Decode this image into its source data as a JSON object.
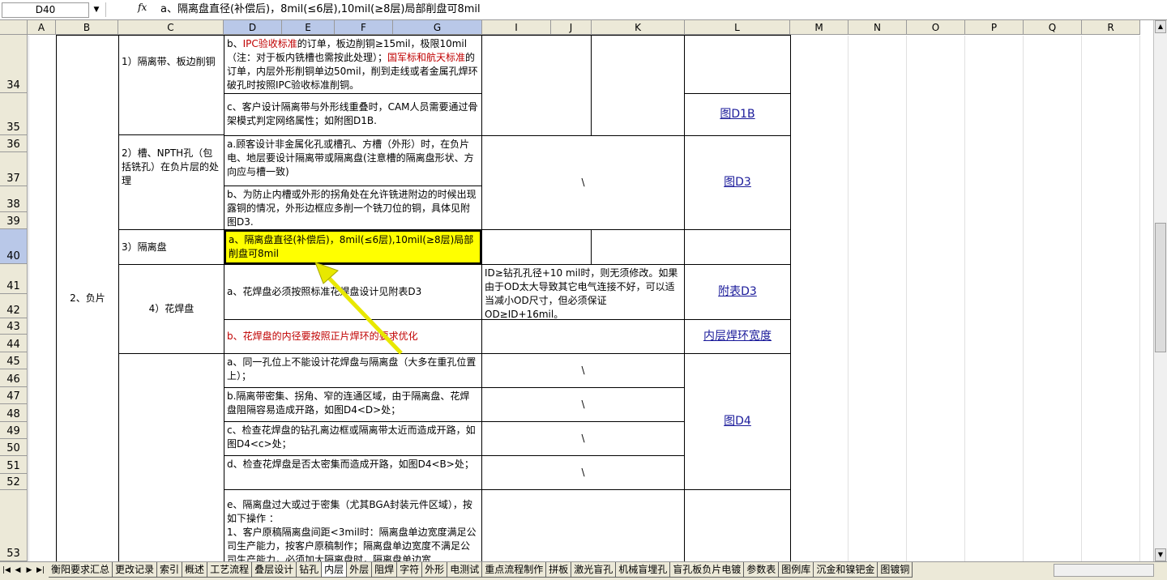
{
  "formula_bar": {
    "name_box": "D40",
    "fx_label": "fx",
    "formula": "a、隔离盘直径(补偿后)，8mil(≤6层),10mil(≥8层)局部削盘可8mil"
  },
  "column_headers": [
    "A",
    "B",
    "C",
    "D",
    "E",
    "F",
    "G",
    "I",
    "J",
    "K",
    "L",
    "M",
    "N",
    "O",
    "P",
    "Q",
    "R"
  ],
  "row_headers": [
    "34",
    "35",
    "36",
    "37",
    "38",
    "39",
    "40",
    "41",
    "42",
    "43",
    "44",
    "45",
    "46",
    "47",
    "48",
    "49",
    "50",
    "51",
    "52",
    "53"
  ],
  "cells": {
    "b_label": "2、负片",
    "c_section1": "1）隔离带、板边削铜",
    "c_section2": "2）槽、NPTH孔（包括铣孔）在负片层的处理",
    "c_section3": "3）隔离盘",
    "c_section4": "4）花焊盘",
    "r34_a": "b、",
    "r34_b": "IPC验收标准",
    "r34_c": "的订单，板边削铜≥15mil，极限10mil（注：对于板内铣槽也需按此处理）；",
    "r34_d": "国军标和航天标准",
    "r34_e": "的订单，内层外形削铜单边50mil，削到走线或者金属孔焊环破孔时按照IPC验收标准削铜。",
    "r35": "c、客户设计隔离带与外形线重叠时，CAM人员需要通过骨架模式判定网络属性；如附图D1B.",
    "r37": "a.顾客设计非金属化孔或槽孔、方槽（外形）时，在负片电、地层要设计隔离带或隔离盘(注意槽的隔离盘形状、方向应与槽一致)",
    "r38": "b、为防止内槽或外形的拐角处在允许铣进附边的时候出现露铜的情况，外形边框应多削一个铣刀位的铜，具体见附图D3.",
    "r40": "a、隔离盘直径(补偿后)，8mil(≤6层),10mil(≥8层)局部削盘可8mil",
    "r41": "a、花焊盘必须按照标准花焊盘设计见附表D3",
    "r41_note": "ID≥钻孔孔径+10 mil时，则无须修改。如果由于OD太大导致其它电气连接不好，可以适当减小OD尺寸，但必须保证OD≥ID+16mil。",
    "r43": "b、花焊盘的内径要按照正片焊环的要求优化",
    "r45": "a、同一孔位上不能设计花焊盘与隔离盘（大多在重孔位置上）；",
    "r47": "b.隔离带密集、拐角、窄的连通区域，由于隔离盘、花焊盘阻隔容易造成开路，如图D4<D>处；",
    "r49": "c、检查花焊盘的钻孔离边框或隔离带太近而造成开路，如图D4<c>处；",
    "r51": "d、检查花焊盘是否太密集而造成开路，如图D4<B>处；",
    "r53": "e、隔离盘过大或过于密集（尤其BGA封装元件区域），按如下操作 ：\n1、客户原稿隔离盘间距<3mil时：隔离盘单边宽度满足公司生产能力，按客户原稿制作；隔离盘单边宽度不满足公司生产能力，必须加大隔离盘时，隔离盘单边宽",
    "backslash": "\\",
    "link_d1b": "图D1B",
    "link_d3": "图D3",
    "link_table_d3": "附表D3",
    "link_inner_ring": "内层焊环宽度",
    "link_d4": "图D4"
  },
  "sheet_tabs": [
    "衡阳要求汇总",
    "更改记录",
    "索引",
    "概述",
    "工艺流程",
    "叠层设计",
    "钻孔",
    "内层",
    "外层",
    "阻焊",
    "字符",
    "外形",
    "电测试",
    "重点流程制作",
    "拼板",
    "激光盲孔",
    "机械盲埋孔",
    "盲孔板负片电镀",
    "参数表",
    "图例库",
    "沉金和镍钯金",
    "图镀铜"
  ],
  "active_tab": "内层",
  "colors": {
    "selection": "#ffff00",
    "header_bg": "#ece9d8",
    "header_selected": "#b9c8e8",
    "red_text": "#c00000",
    "arrow": "#e8e800"
  }
}
